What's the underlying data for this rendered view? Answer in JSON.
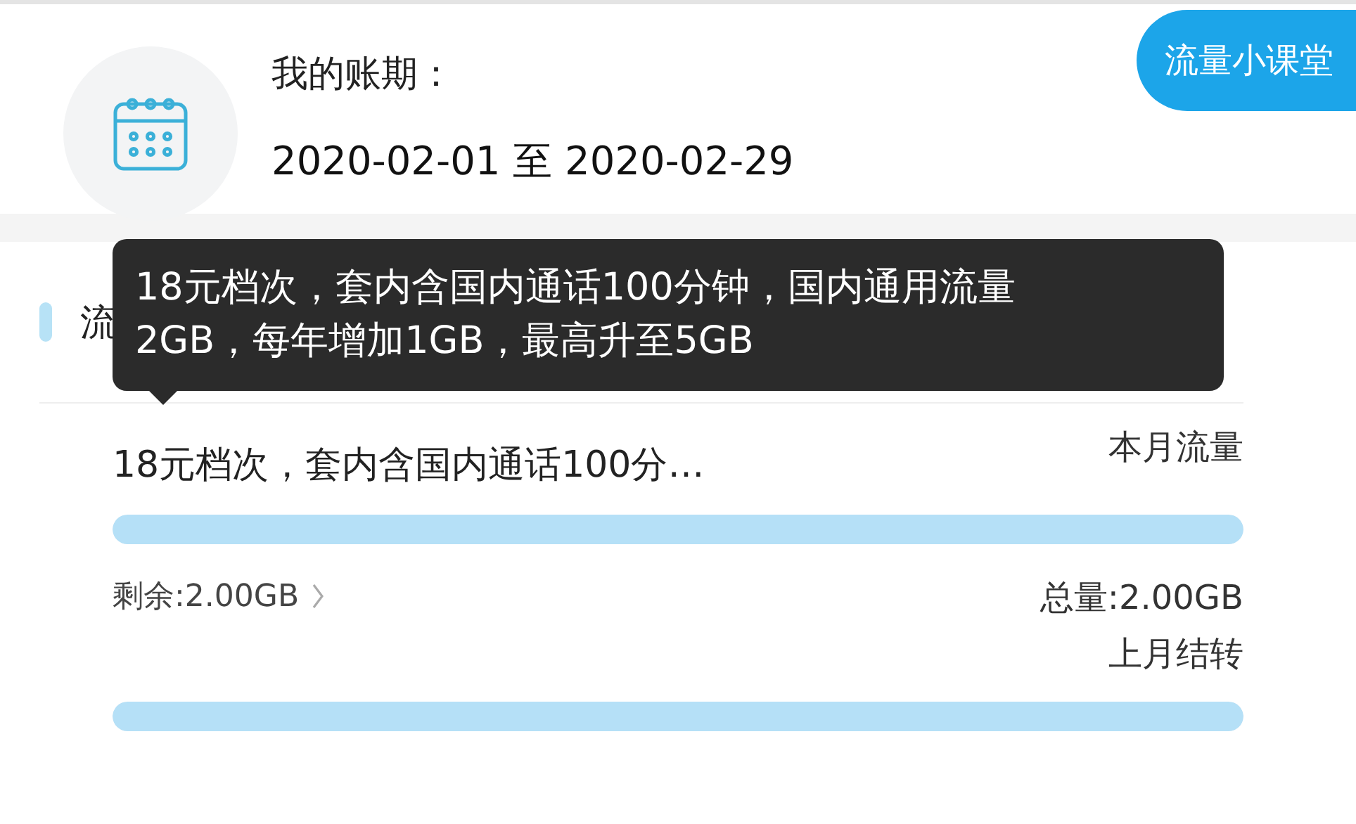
{
  "billing": {
    "label": "我的账期：",
    "period": "2020-02-01 至 2020-02-29"
  },
  "course_button": {
    "label": "流量小课堂"
  },
  "section": {
    "title": "流"
  },
  "tooltip": {
    "lines": [
      "18元档次，套内含国内通话100分钟，国内通用流量",
      "2GB，每年增加1GB，最高升至5GB"
    ]
  },
  "plan": {
    "name": "18元档次，套内含国内通话100分…",
    "remaining": "剩余:2.00GB",
    "total": "总量:2.00GB"
  },
  "meters": [
    {
      "label": "本月流量",
      "level": 1
    },
    {
      "label": "上月结转",
      "level": 1
    }
  ]
}
